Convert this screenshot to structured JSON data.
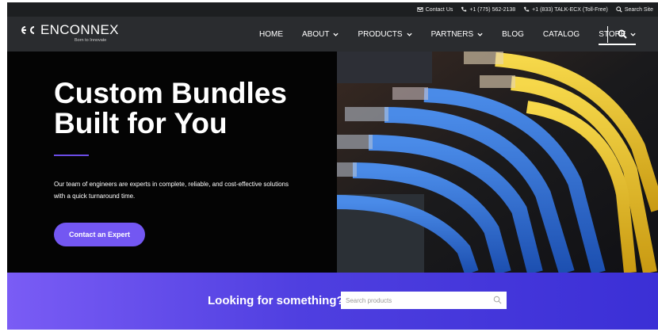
{
  "topbar": {
    "contact": "Contact Us",
    "phone1": "+1 (775) 562-2138",
    "phone2": "+1 (833) TALK-ECX (Toll-Free)",
    "search_site": "Search Site"
  },
  "logo": {
    "word": "ENCONNEX",
    "tagline": "Born to Innovate"
  },
  "nav": {
    "items": [
      {
        "label": "HOME"
      },
      {
        "label": "ABOUT"
      },
      {
        "label": "PRODUCTS"
      },
      {
        "label": "PARTNERS"
      },
      {
        "label": "BLOG"
      },
      {
        "label": "CATALOG"
      },
      {
        "label": "STORE"
      }
    ],
    "active": "STORE"
  },
  "hero": {
    "title_line1": "Custom Bundles",
    "title_line2": "Built for You",
    "body": "Our team of engineers are experts in complete, reliable, and cost-effective solutions with a quick turnaround time.",
    "cta": "Contact an Expert"
  },
  "search_band": {
    "label": "Looking for something?",
    "placeholder": "Search products"
  },
  "colors": {
    "accent": "#7357f2",
    "nav_bg": "#2a2c2f",
    "topbar_bg": "#1d1f21"
  }
}
